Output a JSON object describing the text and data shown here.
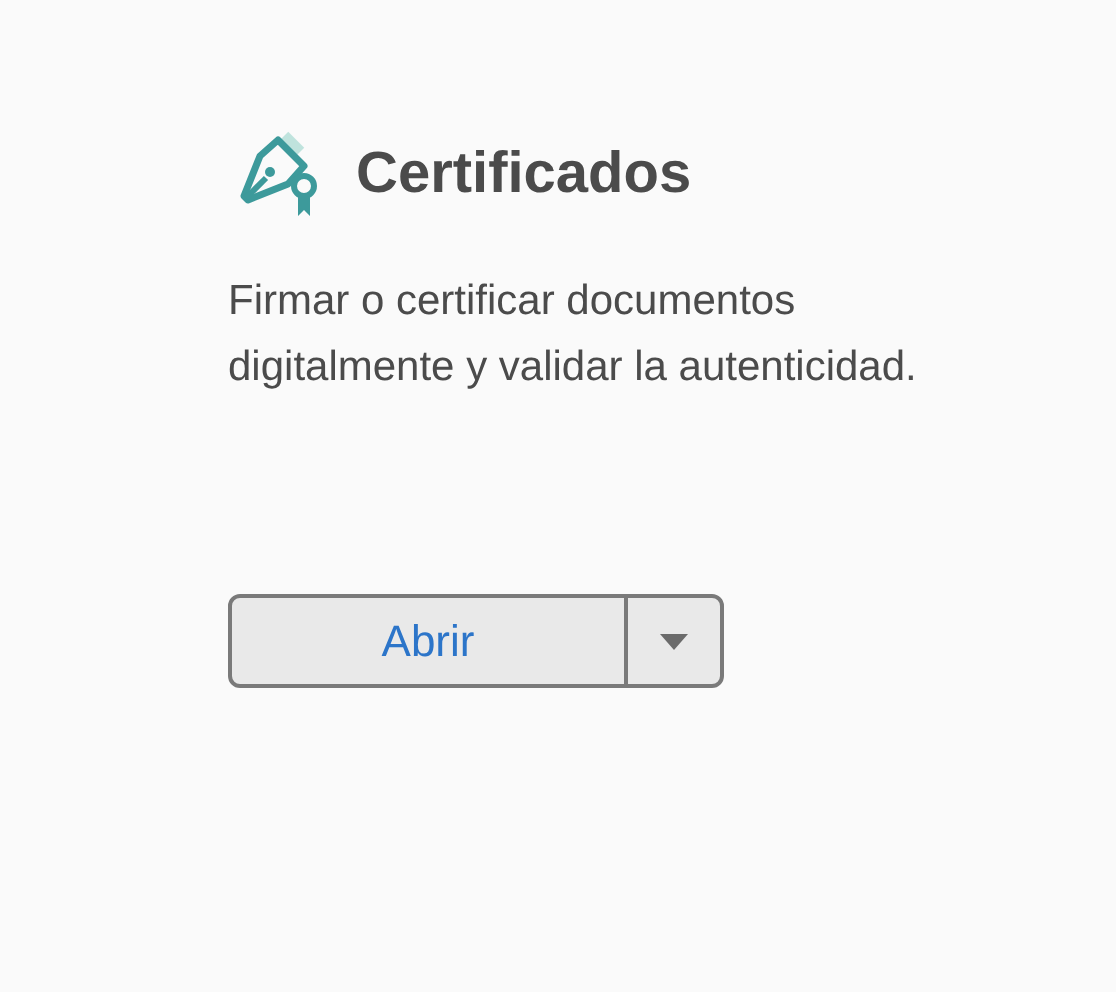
{
  "card": {
    "title": "Certificados",
    "description": "Firmar o certificar documentos digitalmente y validar la autenticidad.",
    "button": {
      "label": "Abrir"
    }
  }
}
